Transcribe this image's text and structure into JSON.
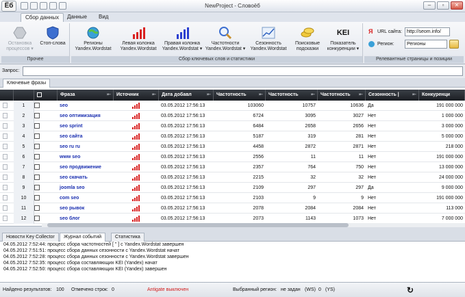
{
  "window": {
    "title": "NewProject - Словоёб",
    "app_logo": "Ёб"
  },
  "ribbon_tabs": [
    "Сбор данных",
    "Данные",
    "Вид"
  ],
  "ribbon": {
    "groups": [
      {
        "label": "Прочее",
        "buttons": [
          {
            "label1": "Остановка",
            "label2": "процессов ▾",
            "icon": "stop-hexagon-icon",
            "disabled": true
          },
          {
            "label1": "Стоп-слова",
            "label2": "",
            "icon": "shield-icon"
          }
        ]
      },
      {
        "label": "Сбор ключевых слов и статистики",
        "buttons": [
          {
            "label1": "Регионы",
            "label2": "Yandex.Wordstat",
            "icon": "globe-icon"
          },
          {
            "label1": "Левая колонка",
            "label2": "Yandex.Wordstat",
            "icon": "red-bars-icon"
          },
          {
            "label1": "Правая колонка",
            "label2": "Yandex.Wordstat ▾",
            "icon": "blue-bars-icon"
          },
          {
            "label1": "Частотности",
            "label2": "Yandex.Wordstat ▾",
            "icon": "magnifier-icon"
          },
          {
            "label1": "Сезонность",
            "label2": "Yandex.Wordstat",
            "icon": "line-chart-icon"
          },
          {
            "label1": "Поисковые",
            "label2": "подсказки",
            "icon": "coins-icon"
          },
          {
            "label1": "Показатель",
            "label2": "конкуренции ▾",
            "icon": "kei-icon",
            "icon_text": "KEI"
          }
        ]
      },
      {
        "label": "Релевантные страницы и позиции"
      }
    ],
    "url_label": "URL сайта:",
    "url_value": "http://seom.info/",
    "region_label": "Регион:",
    "region_value": "Регионы"
  },
  "query": {
    "label": "Запрос:",
    "value": ""
  },
  "tabs": {
    "keywords": "Ключевые фразы"
  },
  "grid": {
    "columns": [
      "Фраза",
      "Источник",
      "Дата добавл",
      "Частотность",
      "Частотность",
      "Частотность",
      "Сезонность |",
      "Конкуренци"
    ],
    "rows": [
      {
        "n": "1",
        "phrase": "seo",
        "date": "03.05.2012 17:56:13",
        "f1": "103060",
        "f2": "10757",
        "f3": "10636",
        "season": "Да",
        "comp": "191 000 000"
      },
      {
        "n": "2",
        "phrase": "seo оптимизация",
        "date": "03.05.2012 17:56:13",
        "f1": "6724",
        "f2": "3095",
        "f3": "3027",
        "season": "Нет",
        "comp": "1 000 000"
      },
      {
        "n": "3",
        "phrase": "seo sprint",
        "date": "03.05.2012 17:56:13",
        "f1": "6484",
        "f2": "2658",
        "f3": "2656",
        "season": "Нет",
        "comp": "3 000 000"
      },
      {
        "n": "4",
        "phrase": "seo сайта",
        "date": "03.05.2012 17:56:13",
        "f1": "5187",
        "f2": "319",
        "f3": "281",
        "season": "Нет",
        "comp": "5 000 000"
      },
      {
        "n": "5",
        "phrase": "seo ru ru",
        "date": "03.05.2012 17:56:13",
        "f1": "4458",
        "f2": "2872",
        "f3": "2871",
        "season": "Нет",
        "comp": "218 000"
      },
      {
        "n": "6",
        "phrase": "www seo",
        "date": "03.05.2012 17:56:13",
        "f1": "2556",
        "f2": "11",
        "f3": "11",
        "season": "Нет",
        "comp": "191 000 000"
      },
      {
        "n": "7",
        "phrase": "seo продвижение",
        "date": "03.05.2012 17:56:13",
        "f1": "2357",
        "f2": "764",
        "f3": "750",
        "season": "Нет",
        "comp": "13 000 000"
      },
      {
        "n": "8",
        "phrase": "seo скачать",
        "date": "03.05.2012 17:56:13",
        "f1": "2215",
        "f2": "32",
        "f3": "32",
        "season": "Нет",
        "comp": "24 000 000"
      },
      {
        "n": "9",
        "phrase": "joomla seo",
        "date": "03.05.2012 17:56:13",
        "f1": "2109",
        "f2": "297",
        "f3": "297",
        "season": "Да",
        "comp": "9 000 000"
      },
      {
        "n": "10",
        "phrase": "com seo",
        "date": "03.05.2012 17:56:13",
        "f1": "2103",
        "f2": "9",
        "f3": "9",
        "season": "Нет",
        "comp": "191 000 000"
      },
      {
        "n": "11",
        "phrase": "seo рывок",
        "date": "03.05.2012 17:56:13",
        "f1": "2078",
        "f2": "2084",
        "f3": "2084",
        "season": "Нет",
        "comp": "113 000"
      },
      {
        "n": "12",
        "phrase": "seo блог",
        "date": "03.05.2012 17:56:13",
        "f1": "2073",
        "f2": "1143",
        "f3": "1073",
        "season": "Нет",
        "comp": "7 000 000"
      }
    ]
  },
  "bottom_tabs": [
    "Новости Key Collector",
    "Журнал событий",
    "Статистика"
  ],
  "log": [
    "04.05.2012 7:52:44: процесс сбора частотностей [ \" ] с Yandex.Wordstat завершен",
    "04.05.2012 7:51:51: процесс сбора данных сезонности с Yandex.Wordstat начат",
    "04.05.2012 7:52:28: процесс сбора данных сезонности с Yandex.Wordstat завершен",
    "04.05.2012 7:52:35: процесс сбора составляющих KEI (Yandex) начат",
    "04.05.2012 7:52:50: процесс сбора составляющих KEI (Yandex) завершен"
  ],
  "status": {
    "found_label": "Найдено результатов:",
    "found_value": "100",
    "marked_label": "Отмечено строк:",
    "marked_value": "0",
    "antigate": "Antigate выключен",
    "region_label": "Выбранный регион:",
    "region_value": "не задан",
    "ws": "(WS)",
    "ws_value": "0",
    "ys": "(YS)"
  },
  "colors": {
    "accent_red": "#d92020",
    "phrase_blue": "#1a2fb0",
    "header_dark": "#1b1e23"
  }
}
